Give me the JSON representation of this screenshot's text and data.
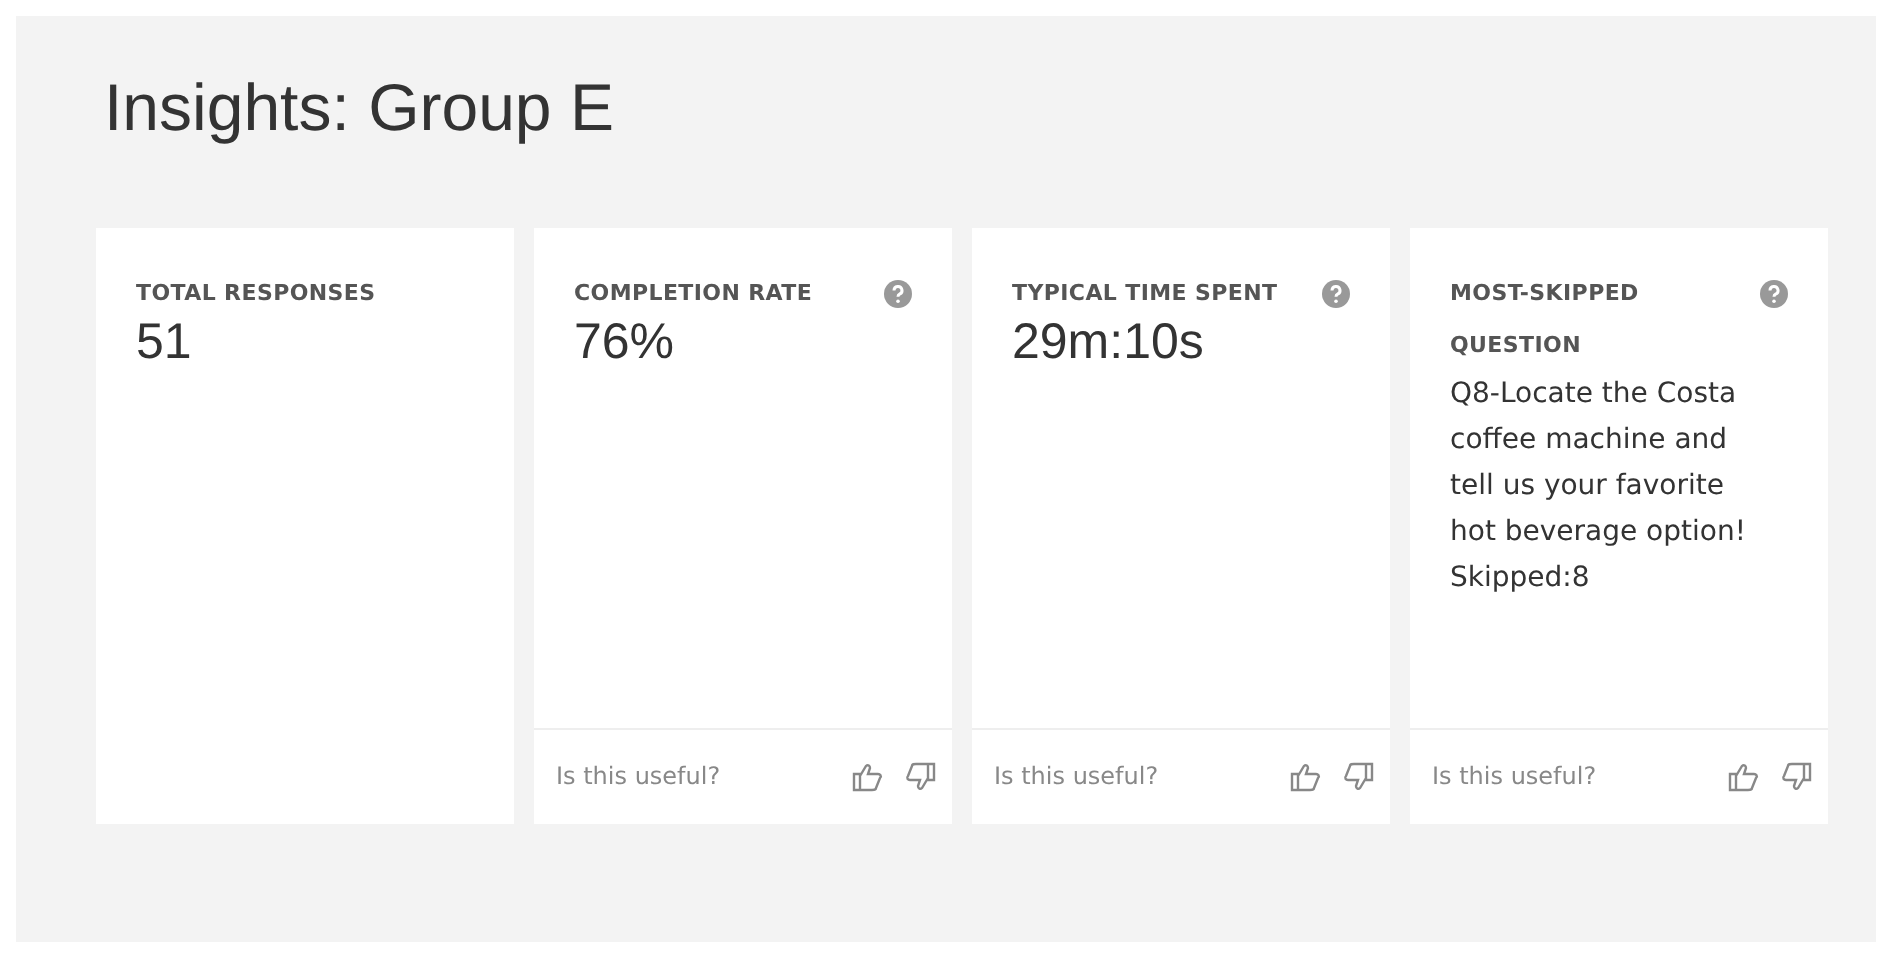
{
  "title": "Insights: Group E",
  "cards": [
    {
      "kind": "metric",
      "label": "TOTAL RESPONSES",
      "value": "51",
      "help": false
    },
    {
      "kind": "metric",
      "label": "COMPLETION RATE",
      "value": "76%",
      "help": true,
      "feedback": "Is this useful?"
    },
    {
      "kind": "metric",
      "label": "TYPICAL TIME SPENT",
      "value": "29m:10s",
      "help": true,
      "feedback": "Is this useful?"
    },
    {
      "kind": "text",
      "label": "MOST-SKIPPED QUESTION",
      "value": "Q8-Locate the Costa coffee machine and tell us your favorite hot beverage option! Skipped:8",
      "help": true,
      "feedback": "Is this useful?"
    }
  ]
}
